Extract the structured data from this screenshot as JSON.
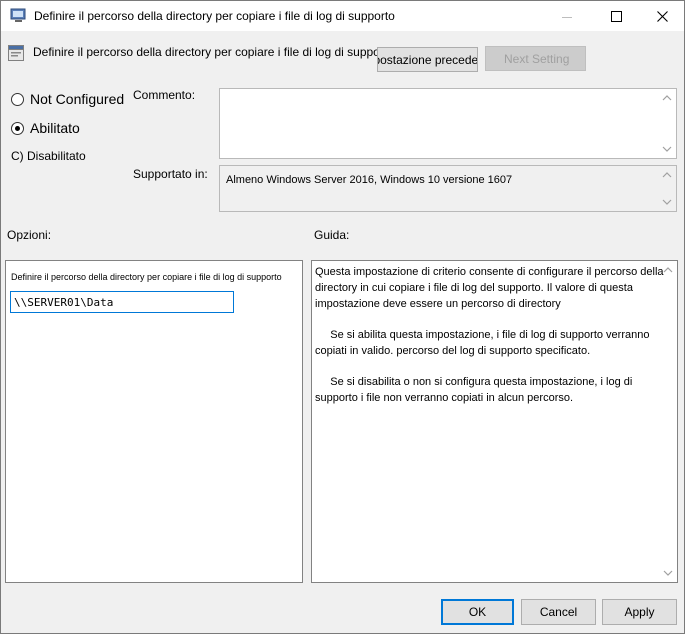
{
  "window": {
    "title": "Definire il percorso della directory per copiare i file di log di supporto",
    "minimize_icon": "minimize-icon",
    "maximize_icon": "maximize-icon",
    "close_icon": "close-icon"
  },
  "header": {
    "title": "Definire il percorso della directory per copiare i file di log di supporto",
    "prev_button": "Impostazione precedente",
    "next_button": "Next Setting"
  },
  "state": {
    "not_configured": "Not Configured",
    "enabled": "Abilitato",
    "disabled": "C) Disabilitato",
    "selected": "enabled"
  },
  "comment": {
    "label": "Commento:",
    "value": ""
  },
  "supported": {
    "label": "Supportato in:",
    "value": "Almeno Windows Server 2016, Windows 10 versione 1607"
  },
  "options": {
    "label": "Opzioni:",
    "field_label": "Definire il percorso della directory  per copiare i file di log  di supporto",
    "field_value": "\\\\SERVER01\\Data"
  },
  "help": {
    "label": "Guida:",
    "paragraphs": [
      "Questa impostazione di criterio consente di configurare il percorso della directory in cui copiare i file di log del supporto. Il valore di questa impostazione deve essere un percorso di directory",
      "     Se si abilita questa impostazione, i file di log di supporto verranno copiati in valido. percorso del log di supporto specificato.",
      "     Se si disabilita o non si configura questa impostazione, i log di supporto i file non verranno copiati in alcun percorso."
    ]
  },
  "footer": {
    "ok": "OK",
    "cancel": "Cancel",
    "apply": "Apply"
  },
  "colors": {
    "focus_blue": "#0078d7",
    "window_bg": "#f0f0f0"
  }
}
